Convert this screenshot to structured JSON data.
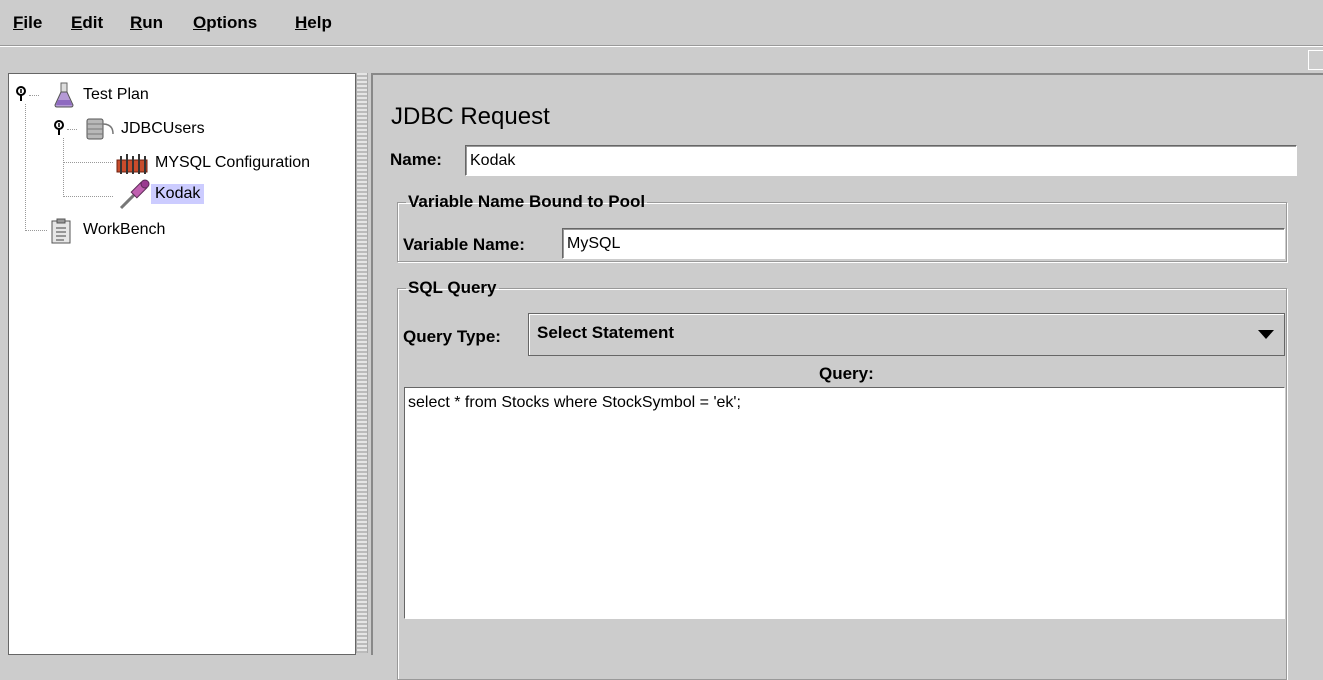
{
  "menu": {
    "file": {
      "mnemonic": "F",
      "rest": "ile"
    },
    "edit": {
      "mnemonic": "E",
      "rest": "dit"
    },
    "run": {
      "mnemonic": "R",
      "rest": "un"
    },
    "options": {
      "mnemonic": "O",
      "rest": "ptions"
    },
    "help": {
      "mnemonic": "H",
      "rest": "elp"
    }
  },
  "tree": {
    "test_plan": "Test Plan",
    "jdbc_users": "JDBCUsers",
    "mysql_config": "MYSQL Configuration",
    "kodak": "Kodak",
    "workbench": "WorkBench"
  },
  "panel": {
    "title": "JDBC Request",
    "name_label": "Name:",
    "name_value": "Kodak",
    "pool_group_label": "Variable Name Bound to Pool",
    "variable_name_label": "Variable Name:",
    "variable_name_value": "MySQL",
    "sql_group_label": "SQL Query",
    "query_type_label": "Query Type:",
    "query_type_value": "Select Statement",
    "query_label": "Query:",
    "query_value": "select * from Stocks where StockSymbol = 'ek';"
  },
  "colors": {
    "selection": "#ccccff",
    "background": "#cccccc"
  },
  "icons": {
    "test_plan": "beaker-icon",
    "jdbc_users": "thread-group-icon",
    "mysql_config": "config-element-icon",
    "kodak": "sampler-pipette-icon",
    "workbench": "workbench-clipboard-icon",
    "toggle": "tree-expand-toggle-icon"
  }
}
